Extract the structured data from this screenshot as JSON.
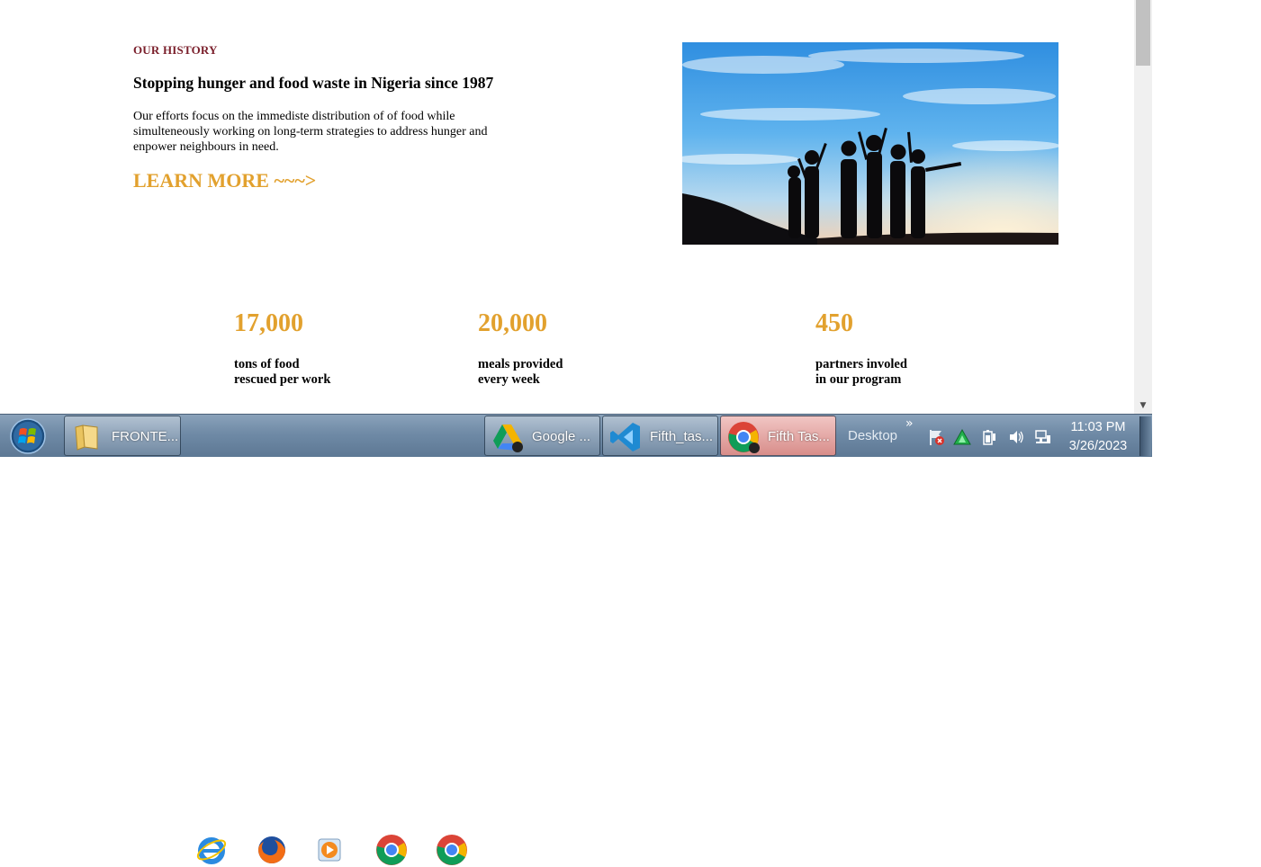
{
  "section": {
    "eyebrow": "OUR HISTORY",
    "headline": "Stopping hunger and food waste in Nigeria since 1987",
    "description": "Our efforts focus on the immediste distribution of of food while simulteneously working on long-term strategies to address hunger and enpower neighbours in need.",
    "cta": "LEARN MORE ~~~>"
  },
  "stats": [
    {
      "value": "17,000",
      "line1": "tons of food",
      "line2": "rescued per work"
    },
    {
      "value": "20,000",
      "line1": "meals provided",
      "line2": "every week"
    },
    {
      "value": "450",
      "line1": "partners involed",
      "line2": "in our program"
    }
  ],
  "taskbar": {
    "tasks": [
      {
        "label": "FRONTE...",
        "icon": "folder-icon"
      },
      {
        "label": "Google ...",
        "icon": "google-drive-icon"
      },
      {
        "label": "Fifth_tas...",
        "icon": "vscode-icon"
      },
      {
        "label": "Fifth Tas...",
        "icon": "chrome-icon"
      }
    ],
    "pinned": [
      "internet-explorer-icon",
      "firefox-icon",
      "media-player-icon",
      "chrome-icon",
      "chrome-icon"
    ],
    "desktop_label": "Desktop",
    "chevron": "»",
    "time": "11:03 PM",
    "date": "3/26/2023"
  },
  "colors": {
    "accent": "#e2a12e",
    "eyebrow": "#7a1f2b",
    "taskbar": "#6f8aa6"
  }
}
